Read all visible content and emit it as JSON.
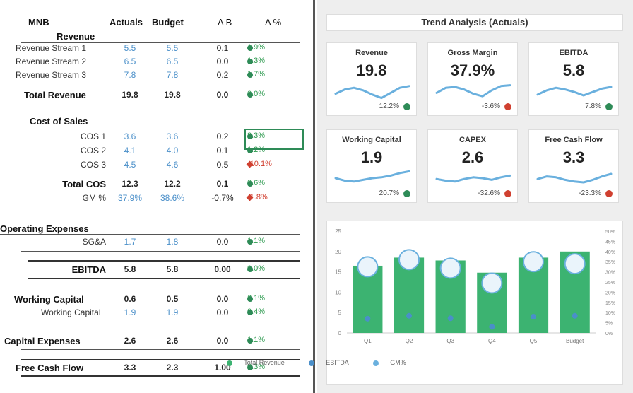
{
  "table": {
    "headers": {
      "title": "MNB",
      "actuals": "Actuals",
      "budget": "Budget",
      "delta": "Δ B",
      "delta_pct": "Δ %"
    },
    "revenue": {
      "section": "Revenue",
      "rows": [
        {
          "label": "Revenue Stream 1",
          "actual": "5.5",
          "budget": "5.5",
          "delta": "0.1",
          "pct": "1.9%",
          "status": "good"
        },
        {
          "label": "Revenue Stream 2",
          "actual": "6.5",
          "budget": "6.5",
          "delta": "0.0",
          "pct": "1.3%",
          "status": "good"
        },
        {
          "label": "Revenue Stream 3",
          "actual": "7.8",
          "budget": "7.8",
          "delta": "0.2",
          "pct": "1.7%",
          "status": "good"
        }
      ],
      "total": {
        "label": "Total Revenue",
        "actual": "19.8",
        "budget": "19.8",
        "delta": "0.0",
        "pct": "0.0%",
        "status": "good"
      }
    },
    "cogs": {
      "section": "Cost of Sales",
      "rows": [
        {
          "label": "COS 1",
          "actual": "3.6",
          "budget": "3.6",
          "delta": "0.2",
          "pct": "3.3%",
          "status": "good"
        },
        {
          "label": "COS 2",
          "actual": "4.1",
          "budget": "4.0",
          "delta": "0.1",
          "pct": "1.2%",
          "status": "good"
        },
        {
          "label": "COS 3",
          "actual": "4.5",
          "budget": "4.6",
          "delta": "0.5",
          "pct": "-10.1%",
          "status": "bad"
        }
      ],
      "total": {
        "label": "Total COS",
        "actual": "12.3",
        "budget": "12.2",
        "delta": "0.1",
        "pct": "0.6%",
        "status": "good"
      },
      "margin": {
        "label": "GM %",
        "actual": "37.9%",
        "budget": "38.6%",
        "delta": "-0.7%",
        "pct": "-1.8%",
        "status": "bad"
      }
    },
    "opex": {
      "section": "Operating Expenses",
      "rows": [
        {
          "label": "SG&A",
          "actual": "1.7",
          "budget": "1.8",
          "delta": "0.0",
          "pct": "1.1%",
          "status": "good"
        }
      ]
    },
    "ebitda": {
      "label": "EBITDA",
      "actual": "5.8",
      "budget": "5.8",
      "delta": "0.00",
      "pct": "0.0%",
      "status": "good"
    },
    "wc": {
      "label": "Working Capital",
      "actual": "0.6",
      "budget": "0.5",
      "delta": "0.0",
      "pct": "6.1%",
      "status": "good",
      "sub": {
        "label": "Working Capital",
        "actual": "1.9",
        "budget": "1.9",
        "delta": "0.0",
        "pct": "0.4%",
        "status": "good"
      }
    },
    "capex": {
      "label": "Capital Expenses",
      "actual": "2.6",
      "budget": "2.6",
      "delta": "0.0",
      "pct": "1.1%",
      "status": "good"
    },
    "fcf": {
      "label": "Free Cash Flow",
      "actual": "3.3",
      "budget": "2.3",
      "delta": "1.00",
      "pct": "0.3%",
      "status": "good"
    }
  },
  "trend": {
    "title": "Trend Analysis (Actuals)",
    "cards": [
      {
        "title": "Revenue",
        "value": "19.8",
        "pct": "12.2%",
        "status": "good",
        "trend": [
          0.35,
          0.6,
          0.7,
          0.55,
          0.3,
          0.1,
          0.4,
          0.7,
          0.8
        ]
      },
      {
        "title": "Gross Margin",
        "value": "37.9%",
        "pct": "-3.6%",
        "status": "bad",
        "trend": [
          0.4,
          0.7,
          0.75,
          0.6,
          0.35,
          0.2,
          0.55,
          0.8,
          0.85
        ]
      },
      {
        "title": "EBITDA",
        "value": "5.8",
        "pct": "7.8%",
        "status": "good",
        "trend": [
          0.3,
          0.55,
          0.7,
          0.6,
          0.45,
          0.25,
          0.45,
          0.65,
          0.75
        ]
      },
      {
        "title": "Working Capital",
        "value": "1.9",
        "pct": "20.7%",
        "status": "good",
        "trend": [
          0.5,
          0.35,
          0.3,
          0.4,
          0.5,
          0.55,
          0.65,
          0.8,
          0.9
        ]
      },
      {
        "title": "CAPEX",
        "value": "2.6",
        "pct": "-32.6%",
        "status": "bad",
        "trend": [
          0.45,
          0.35,
          0.3,
          0.45,
          0.55,
          0.5,
          0.4,
          0.55,
          0.65
        ]
      },
      {
        "title": "Free Cash Flow",
        "value": "3.3",
        "pct": "-23.3%",
        "status": "bad",
        "trend": [
          0.45,
          0.6,
          0.55,
          0.4,
          0.3,
          0.25,
          0.4,
          0.6,
          0.75
        ]
      }
    ]
  },
  "chart_data": {
    "type": "bar",
    "categories": [
      "Q1",
      "Q2",
      "Q3",
      "Q4",
      "Q5",
      "Budget"
    ],
    "series": [
      {
        "name": "Total Revenue",
        "values": [
          16.5,
          18.5,
          17.8,
          14.8,
          18.5,
          20.0
        ]
      },
      {
        "name": "EBITDA",
        "values": [
          3.5,
          4.2,
          3.6,
          1.5,
          4.0,
          4.2
        ]
      },
      {
        "name": "GM%",
        "values": [
          32.5,
          36.0,
          31.8,
          24.5,
          35.0,
          34.0
        ]
      }
    ],
    "left_ticks": [
      "0",
      "5",
      "10",
      "15",
      "20",
      "25"
    ],
    "right_ticks": [
      "0%",
      "5%",
      "10%",
      "15%",
      "20%",
      "25%",
      "30%",
      "35%",
      "40%",
      "45%",
      "50%"
    ],
    "ylim": [
      0,
      25
    ],
    "y2lim": [
      0,
      50
    ],
    "legend": "bottom"
  },
  "colors": {
    "good": "#2e8b57",
    "bad": "#d04030",
    "bar": "#3cb371",
    "line": "#6ab0de",
    "accent": "#4a8fc9"
  }
}
